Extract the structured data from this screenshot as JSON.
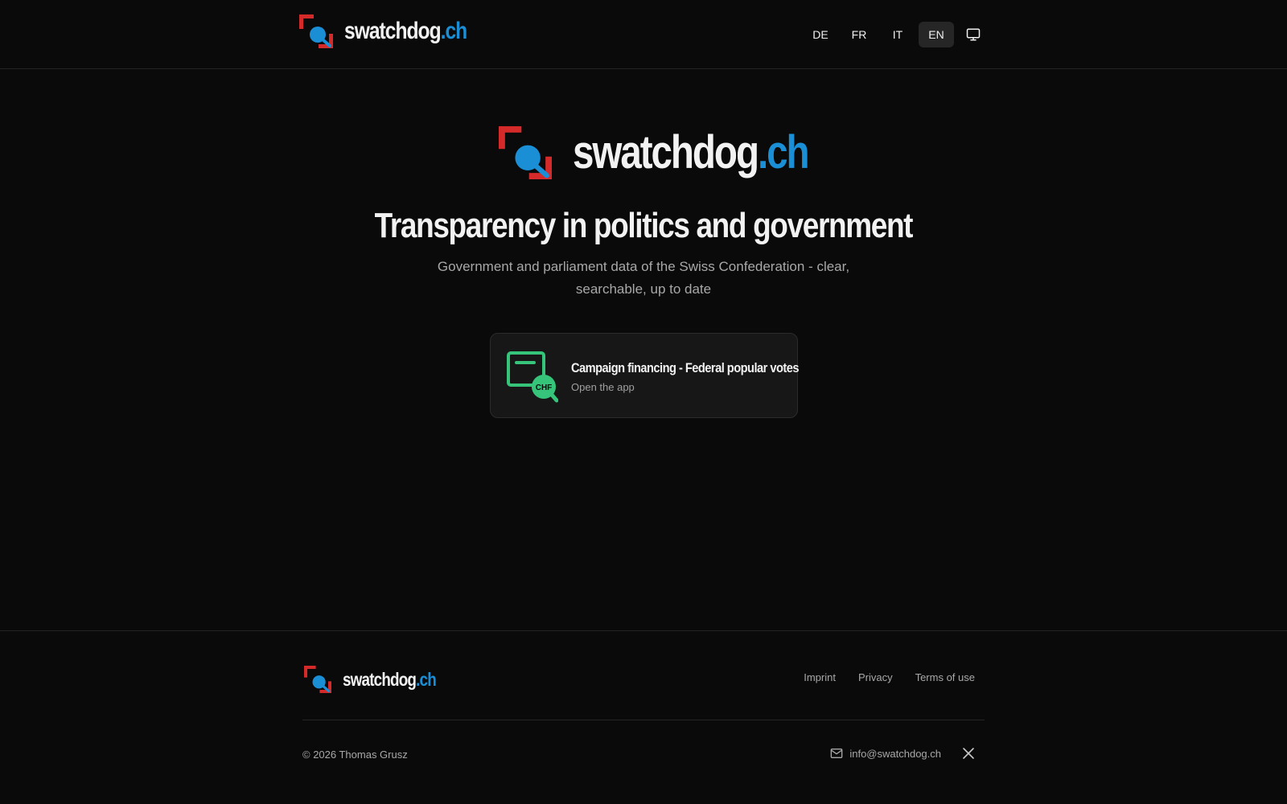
{
  "header": {
    "brand": {
      "name": "swatchdog",
      "domain": ".ch"
    },
    "languages": [
      {
        "code": "DE",
        "active": false
      },
      {
        "code": "FR",
        "active": false
      },
      {
        "code": "IT",
        "active": false
      },
      {
        "code": "EN",
        "active": true
      }
    ],
    "theme_icon": "monitor-icon"
  },
  "hero": {
    "brand": {
      "name": "swatchdog",
      "domain": ".ch"
    },
    "title": "Transparency in politics and government",
    "subtitle": "Government and parliament data of the Swiss Confederation - clear, searchable, up to date"
  },
  "app_card": {
    "title": "Campaign financing - Federal popular votes",
    "subtitle": "Open the app",
    "icon_text": "CHF",
    "icon": "document-search-chf-icon"
  },
  "footer": {
    "brand": {
      "name": "swatchdog",
      "domain": ".ch"
    },
    "links": [
      "Imprint",
      "Privacy",
      "Terms of use"
    ],
    "copyright": "© 2026 Thomas Grusz",
    "email": "info@swatchdog.ch",
    "social_icon": "x-icon"
  },
  "colors": {
    "background": "#0a0a0a",
    "brand_blue": "#1a8fd6",
    "brand_red": "#d42a2a",
    "app_green": "#35c47a",
    "card_bg": "#171717"
  }
}
